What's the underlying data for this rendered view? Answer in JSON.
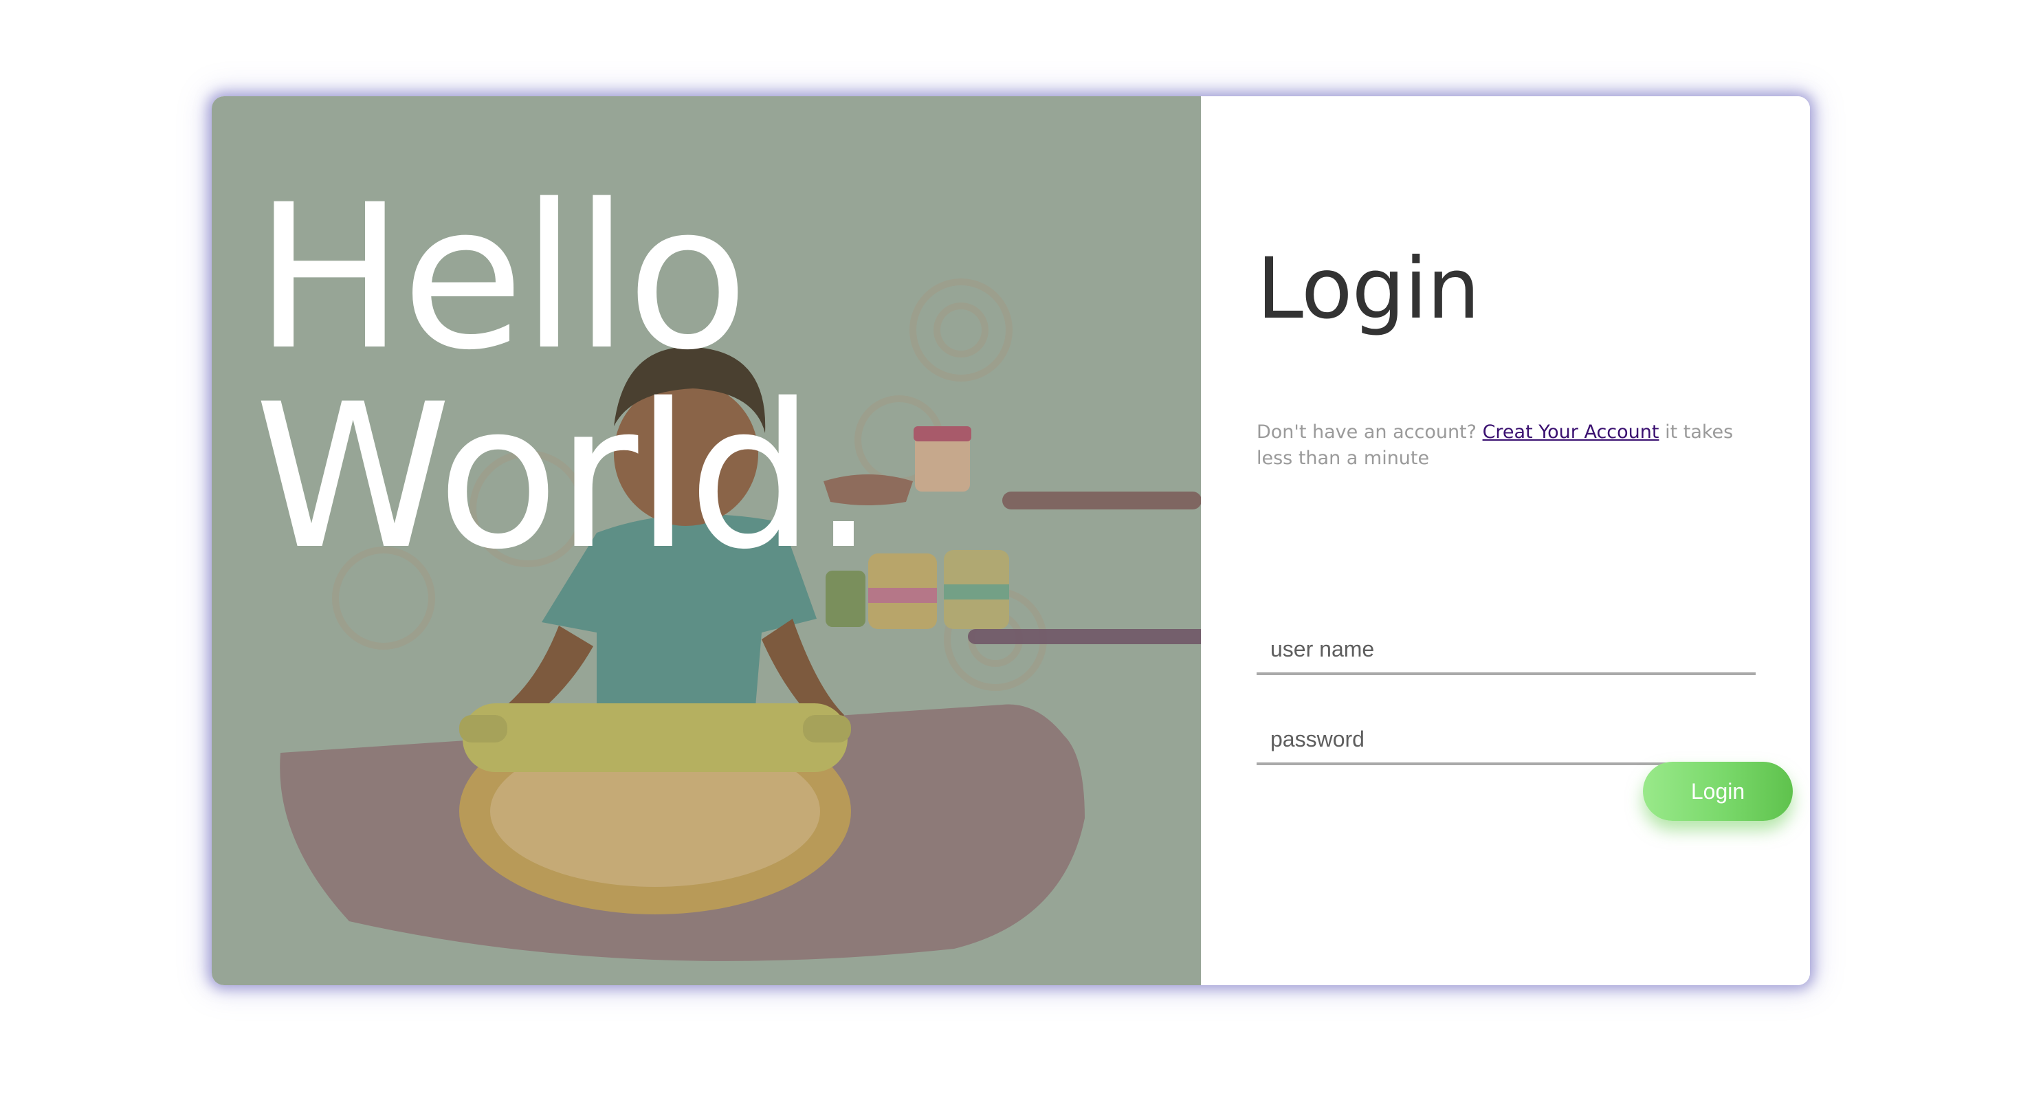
{
  "hero": {
    "line1": "Hello",
    "line2": "World."
  },
  "login": {
    "title": "Login",
    "signup_prefix": "Don't have an account? ",
    "signup_link": "Creat Your Account",
    "signup_suffix": " it takes less than a minute",
    "username_placeholder": "user name",
    "password_placeholder": "password",
    "button_label": "Login"
  },
  "colors": {
    "hero_overlay": "#97a596",
    "button_green": "#79d86a",
    "link_purple": "#3a1070",
    "card_glow": "#6e69be"
  }
}
